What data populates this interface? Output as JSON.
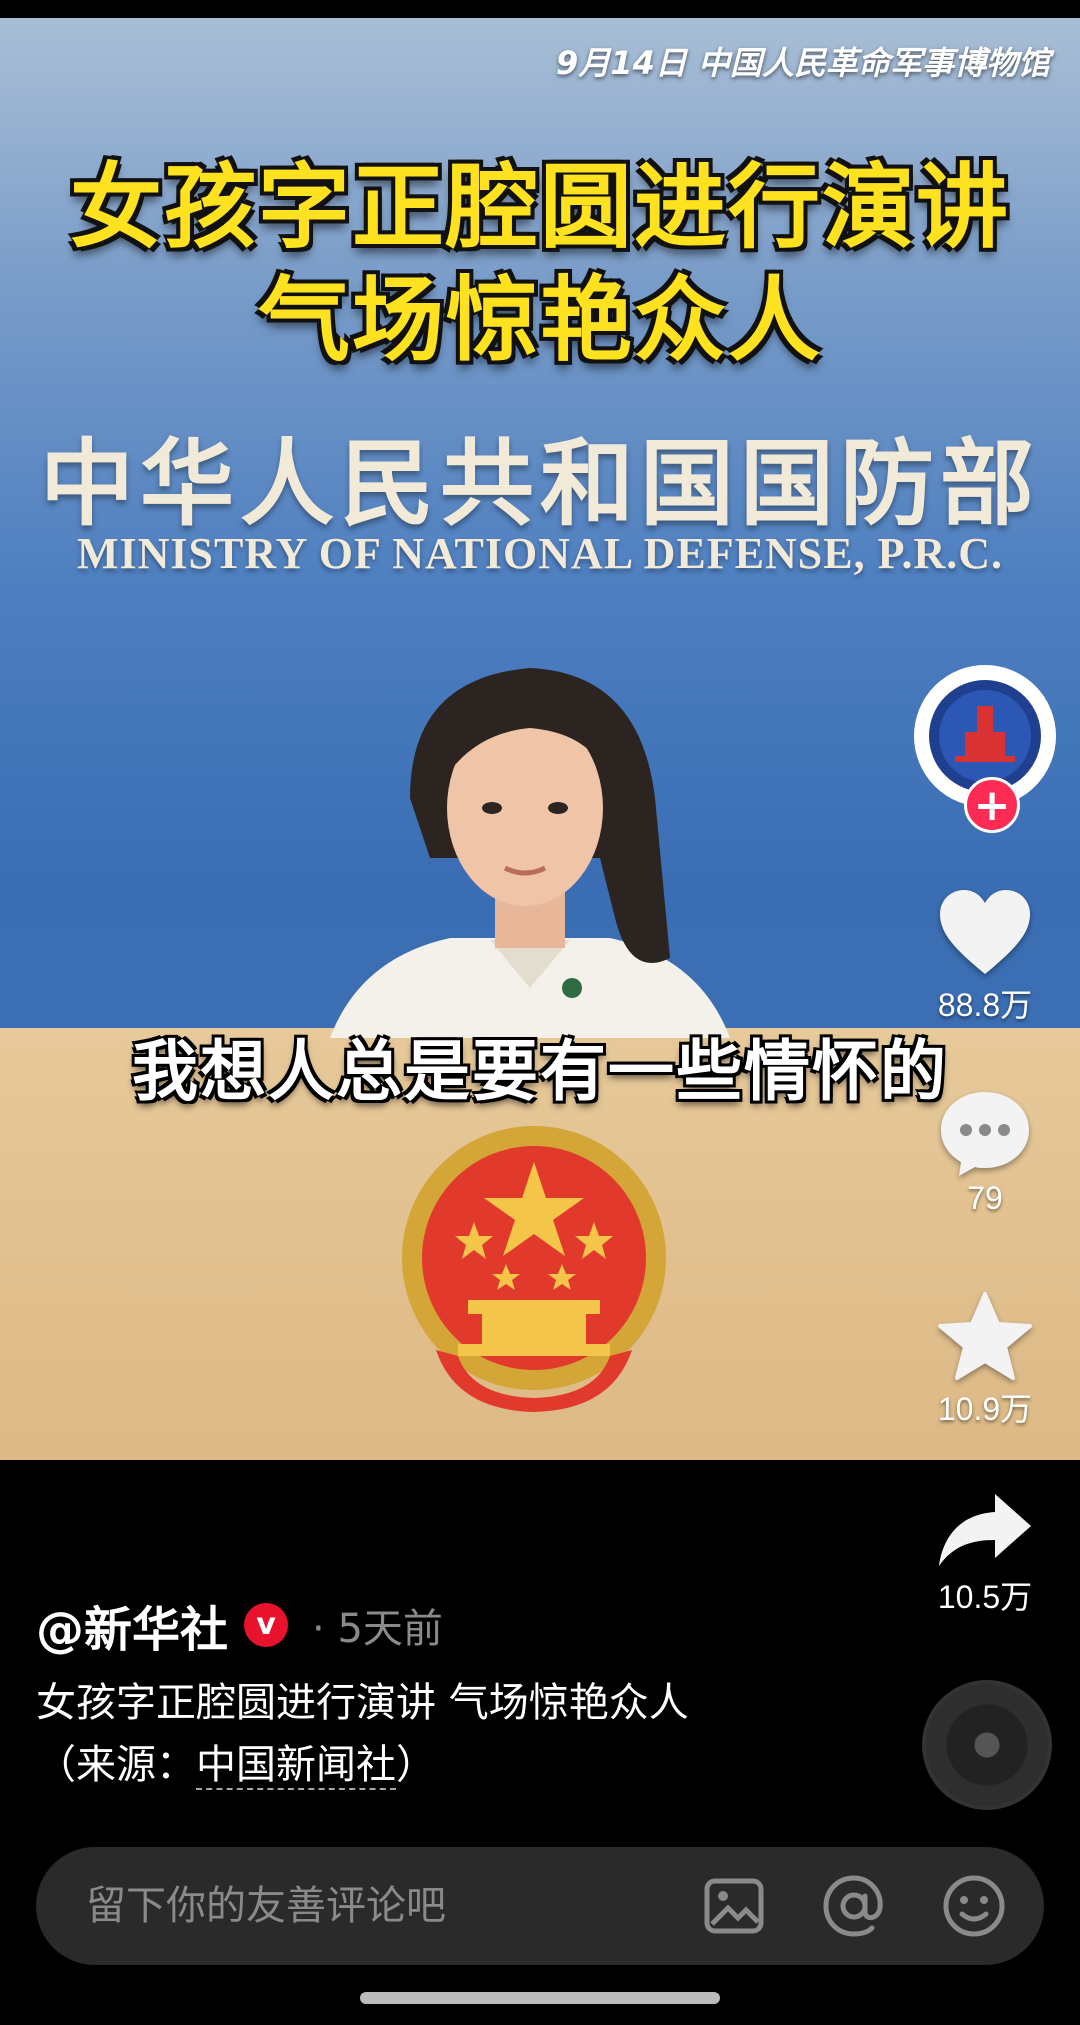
{
  "video": {
    "meta_line": "9月14日 中国人民革命军事博物馆",
    "headline_line1": "女孩字正腔圆进行演讲",
    "headline_line2": "气场惊艳众人",
    "backdrop_cn": "中华人民共和国国防部",
    "backdrop_en": "MINISTRY OF NATIONAL DEFENSE, P.R.C.",
    "subtitle": "我想人总是要有一些情怀的"
  },
  "actions": {
    "follow_label": "+",
    "likes": "88.8万",
    "comments": "79",
    "favorites": "10.9万",
    "shares": "10.5万"
  },
  "post": {
    "author": "@新华社",
    "verified_mark": "v",
    "time": "· 5天前",
    "description": "女孩字正腔圆进行演讲 气场惊艳众人",
    "source_prefix": "（来源：",
    "source_link": "中国新闻社",
    "source_suffix": "）"
  },
  "comment_bar": {
    "placeholder": "留下你的友善评论吧"
  },
  "colors": {
    "accent_red": "#fe2c55",
    "headline_yellow": "#ffe21f"
  },
  "icons": [
    "image-icon",
    "at-icon",
    "emoji-icon",
    "heart-icon",
    "comment-icon",
    "star-icon",
    "share-icon",
    "music-disc-icon"
  ]
}
